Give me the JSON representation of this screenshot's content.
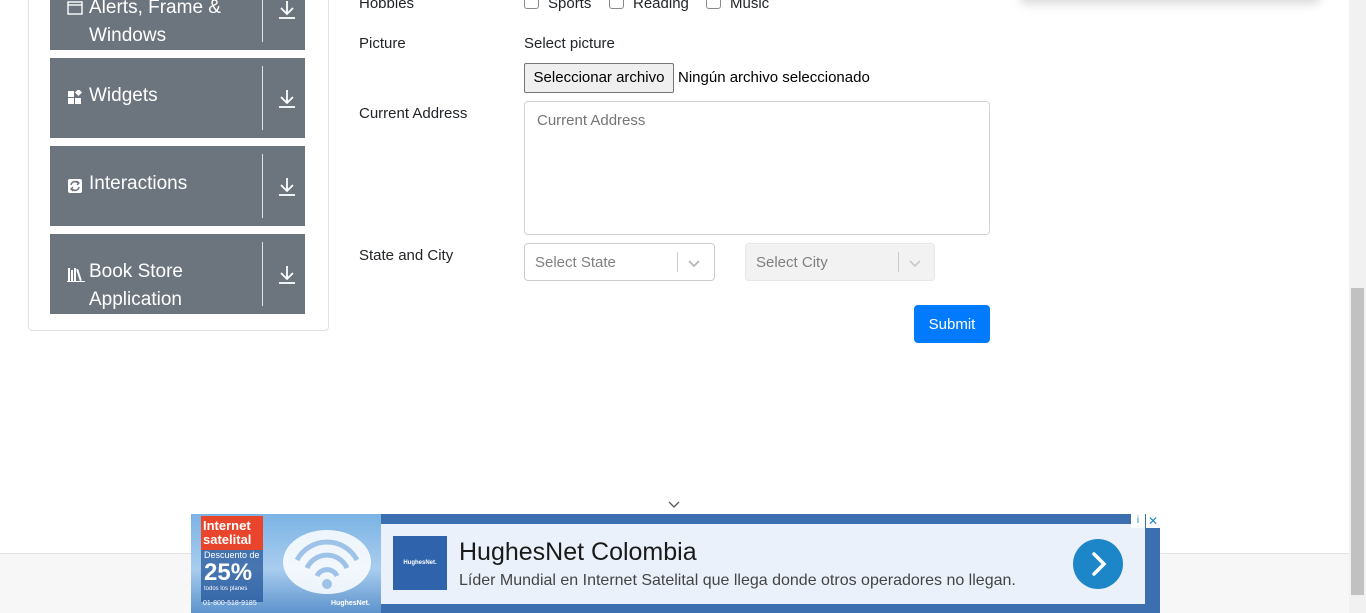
{
  "sidebar": {
    "groups": [
      {
        "label_line1": "Alerts, Frame &",
        "label_line2": "Windows",
        "icon": "window-icon"
      },
      {
        "label_line1": "Widgets",
        "label_line2": "",
        "icon": "widgets-icon"
      },
      {
        "label_line1": "Interactions",
        "label_line2": "",
        "icon": "interactions-icon"
      },
      {
        "label_line1": "Book Store",
        "label_line2": "Application",
        "icon": "book-icon"
      }
    ]
  },
  "form": {
    "hobbies_label": "Hobbies",
    "hobbies": [
      "Sports",
      "Reading",
      "Music"
    ],
    "picture_label": "Picture",
    "picture_caption": "Select picture",
    "file_button": "Seleccionar archivo",
    "file_status": "Ningún archivo seleccionado",
    "address_label": "Current Address",
    "address_placeholder": "Current Address",
    "state_city_label": "State and City",
    "state_placeholder": "Select State",
    "city_placeholder": "Select City",
    "submit_label": "Submit"
  },
  "ad": {
    "promo_line1": "Internet",
    "promo_line2": "satelital",
    "discount_caption": "Descuento de",
    "discount_value": "25%",
    "discount_note": "todos los planes",
    "phone": "01-800-518-9185",
    "brand_small": "HughesNet.",
    "logo_text": "HughesNet.",
    "title": "HughesNet Colombia",
    "description": "Líder Mundial en Internet Satelital que llega donde otros operadores no llegan.",
    "info_symbol": "i",
    "close_symbol": "✕"
  }
}
